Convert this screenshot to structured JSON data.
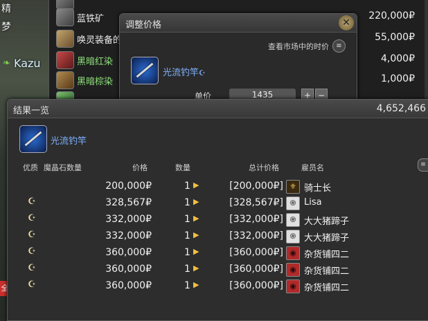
{
  "scene": {
    "top_text": "精",
    "text2": "梦",
    "player_tag": "Kazu",
    "bottom_badge": "全"
  },
  "market_list": {
    "rows": [
      {
        "name": "",
        "price": "",
        "thumb": "gray"
      },
      {
        "name": "蓝铁矿",
        "price": "220,000₽",
        "thumb": "gray"
      },
      {
        "name": "唤灵装备的",
        "price": "55,000₽",
        "thumb": "box"
      },
      {
        "name": "黑暗红染",
        "price": "4,000₽",
        "thumb": "red"
      },
      {
        "name": "黑暗棕染",
        "price": "1,000₽",
        "thumb": "brown"
      }
    ]
  },
  "adjust_window": {
    "title": "调整价格",
    "close_icon": "close-icon",
    "market_link": "查看市场中的时价",
    "item_name": "光流钓竿",
    "hq_mark": "☪",
    "unit_label": "单价",
    "unit_value": "1435"
  },
  "result_window": {
    "title": "结果一览",
    "gil": "4,652,466",
    "item_name": "光流钓竿",
    "headers": {
      "hq": "优质",
      "materia": "魔晶石数量",
      "price": "价格",
      "qty": "数量",
      "total": "总计价格",
      "retainer": "雇员名"
    },
    "rows": [
      {
        "hq": false,
        "price": "200,000₽",
        "qty": "1",
        "total": "[200,000₽]",
        "city": "gridania",
        "retainer": "骑士长"
      },
      {
        "hq": true,
        "price": "328,567₽",
        "qty": "1",
        "total": "[328,567₽]",
        "city": "ishgard",
        "retainer": "Lisa"
      },
      {
        "hq": true,
        "price": "332,000₽",
        "qty": "1",
        "total": "[332,000₽]",
        "city": "ishgard",
        "retainer": "大大猪蹄子"
      },
      {
        "hq": true,
        "price": "332,000₽",
        "qty": "1",
        "total": "[332,000₽]",
        "city": "ishgard",
        "retainer": "大大猪蹄子"
      },
      {
        "hq": true,
        "price": "360,000₽",
        "qty": "1",
        "total": "[360,000₽]",
        "city": "kugane",
        "retainer": "杂货铺四二"
      },
      {
        "hq": true,
        "price": "360,000₽",
        "qty": "1",
        "total": "[360,000₽]",
        "city": "kugane",
        "retainer": "杂货铺四二"
      },
      {
        "hq": true,
        "price": "360,000₽",
        "qty": "1",
        "total": "[360,000₽]",
        "city": "kugane",
        "retainer": "杂货铺四二"
      }
    ]
  }
}
